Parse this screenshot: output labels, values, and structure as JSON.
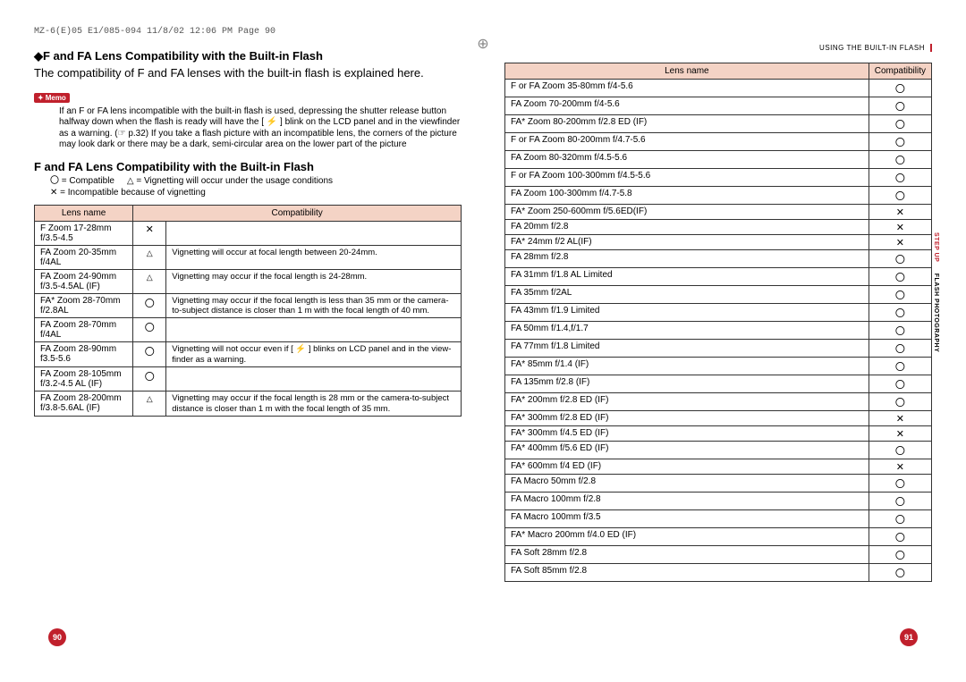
{
  "print_header": "MZ-6(E)05 E1/085-094  11/8/02 12:06 PM  Page 90",
  "running_head_right": "USING THE BUILT-IN FLASH",
  "section_title": "◆F and FA Lens Compatibility with the Built-in Flash",
  "intro": "The compatibility of F and FA lenses with the built-in flash is explained here.",
  "memo_label": "Memo",
  "memo_text": "If an F or FA lens incompatible with the built-in flash is used, depressing the shutter release button halfway down when the flash is ready will have the [ ⚡ ] blink on the LCD panel and in the viewfinder as a warning. (☞ p.32) If you take a flash picture with an incompatible lens, the corners of the picture may look dark or there may be a dark, semi-circular area on the lower part of the picture",
  "tbl_title": "F and FA Lens Compatibility with the Built-in Flash",
  "legend": {
    "circle": "〇 = Compatible",
    "triangle": "△ = Vignetting will occur under the usage conditions",
    "cross": "✕ = Incompatible because of vignetting"
  },
  "table_headers": {
    "lens": "Lens name",
    "compat": "Compatibility"
  },
  "left_rows": [
    {
      "lens": "F Zoom 17-28mm f/3.5-4.5",
      "sym": "✕",
      "note": ""
    },
    {
      "lens": "FA Zoom 20-35mm f/4AL",
      "sym": "△",
      "note": "Vignetting will occur at focal length between 20-24mm."
    },
    {
      "lens": "FA Zoom 24-90mm f/3.5-4.5AL (IF)",
      "sym": "△",
      "note": "Vignetting may occur if the focal length is 24-28mm."
    },
    {
      "lens": "FA* Zoom 28-70mm f/2.8AL",
      "sym": "〇",
      "note": "Vignetting may occur if the focal length is less than 35 mm or the camera-to-subject distance is closer than 1 m with the focal length of 40 mm."
    },
    {
      "lens": "FA Zoom 28-70mm f/4AL",
      "sym": "〇",
      "note": ""
    },
    {
      "lens": "FA Zoom 28-90mm f3.5-5.6",
      "sym": "〇",
      "note": "Vignetting will not occur even if [ ⚡ ] blinks on LCD panel and in the view-finder as a warning."
    },
    {
      "lens": "FA Zoom 28-105mm f/3.2-4.5 AL (IF)",
      "sym": "〇",
      "note": ""
    },
    {
      "lens": "FA Zoom 28-200mm f/3.8-5.6AL (IF)",
      "sym": "△",
      "note": "Vignetting may occur if the focal length is 28 mm or the camera-to-subject distance is closer than 1 m with the focal length of 35 mm."
    }
  ],
  "right_rows": [
    {
      "lens": "F or FA Zoom 35-80mm f/4-5.6",
      "sym": "〇"
    },
    {
      "lens": "FA Zoom 70-200mm f/4-5.6",
      "sym": "〇"
    },
    {
      "lens": "FA* Zoom  80-200mm f/2.8 ED (IF)",
      "sym": "〇"
    },
    {
      "lens": "F or FA Zoom 80-200mm f/4.7-5.6",
      "sym": "〇"
    },
    {
      "lens": "FA Zoom 80-320mm f/4.5-5.6",
      "sym": "〇"
    },
    {
      "lens": "F or FA Zoom 100-300mm f/4.5-5.6",
      "sym": "〇"
    },
    {
      "lens": "FA Zoom 100-300mm f/4.7-5.8",
      "sym": "〇"
    },
    {
      "lens": "FA* Zoom 250-600mm f/5.6ED(IF)",
      "sym": "✕"
    },
    {
      "lens": "FA 20mm f/2.8",
      "sym": "✕"
    },
    {
      "lens": "FA* 24mm f/2 AL(IF)",
      "sym": "✕"
    },
    {
      "lens": "FA 28mm f/2.8",
      "sym": "〇"
    },
    {
      "lens": "FA 31mm f/1.8 AL Limited",
      "sym": "〇"
    },
    {
      "lens": "FA 35mm f/2AL",
      "sym": "〇"
    },
    {
      "lens": "FA 43mm f/1.9 Limited",
      "sym": "〇"
    },
    {
      "lens": "FA 50mm f/1.4,f/1.7",
      "sym": "〇"
    },
    {
      "lens": "FA 77mm f/1.8 Limited",
      "sym": "〇"
    },
    {
      "lens": "FA* 85mm f/1.4 (IF)",
      "sym": "〇"
    },
    {
      "lens": "FA 135mm f/2.8 (IF)",
      "sym": "〇"
    },
    {
      "lens": "FA* 200mm f/2.8 ED (IF)",
      "sym": "〇"
    },
    {
      "lens": "FA* 300mm f/2.8 ED (IF)",
      "sym": "✕"
    },
    {
      "lens": "FA* 300mm f/4.5 ED (IF)",
      "sym": "✕"
    },
    {
      "lens": "FA* 400mm f/5.6 ED (IF)",
      "sym": "〇"
    },
    {
      "lens": "FA* 600mm f/4 ED (IF)",
      "sym": "✕"
    },
    {
      "lens": "FA Macro 50mm f/2.8",
      "sym": "〇"
    },
    {
      "lens": "FA Macro 100mm f/2.8",
      "sym": "〇"
    },
    {
      "lens": "FA Macro 100mm f/3.5",
      "sym": "〇"
    },
    {
      "lens": "FA* Macro 200mm f/4.0 ED (IF)",
      "sym": "〇"
    },
    {
      "lens": "FA Soft 28mm f/2.8",
      "sym": "〇"
    },
    {
      "lens": "FA Soft 85mm f/2.8",
      "sym": "〇"
    }
  ],
  "side_tab": {
    "red": "STEP UP",
    "black": "FLASH PHOTOGRAPHY"
  },
  "page_left": "90",
  "page_right": "91"
}
